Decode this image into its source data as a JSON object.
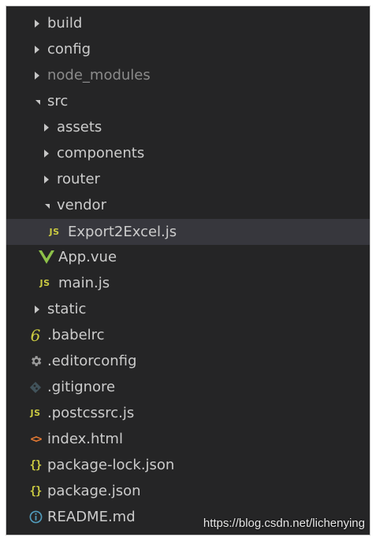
{
  "explorer": {
    "items": [
      {
        "label": "build",
        "kind": "folder",
        "state": "collapsed",
        "icon": "chevron-right-icon"
      },
      {
        "label": "config",
        "kind": "folder",
        "state": "collapsed",
        "icon": "chevron-right-icon"
      },
      {
        "label": "node_modules",
        "kind": "folder",
        "state": "collapsed",
        "icon": "chevron-right-icon",
        "dimmed": true
      },
      {
        "label": "src",
        "kind": "folder",
        "state": "expanded",
        "icon": "chevron-down-icon"
      },
      {
        "label": "assets",
        "kind": "folder",
        "state": "collapsed",
        "icon": "chevron-right-icon"
      },
      {
        "label": "components",
        "kind": "folder",
        "state": "collapsed",
        "icon": "chevron-right-icon"
      },
      {
        "label": "router",
        "kind": "folder",
        "state": "collapsed",
        "icon": "chevron-right-icon"
      },
      {
        "label": "vendor",
        "kind": "folder",
        "state": "expanded",
        "icon": "chevron-down-icon"
      },
      {
        "label": "Export2Excel.js",
        "kind": "file",
        "icon": "js-file-icon",
        "icon_text": "JS",
        "selected": true
      },
      {
        "label": "App.vue",
        "kind": "file",
        "icon": "vue-file-icon"
      },
      {
        "label": "main.js",
        "kind": "file",
        "icon": "js-file-icon",
        "icon_text": "JS"
      },
      {
        "label": "static",
        "kind": "folder",
        "state": "collapsed",
        "icon": "chevron-right-icon"
      },
      {
        "label": ".babelrc",
        "kind": "file",
        "icon": "babel-file-icon",
        "icon_text": "6"
      },
      {
        "label": ".editorconfig",
        "kind": "file",
        "icon": "gear-icon"
      },
      {
        "label": ".gitignore",
        "kind": "file",
        "icon": "git-icon"
      },
      {
        "label": ".postcssrc.js",
        "kind": "file",
        "icon": "js-file-icon",
        "icon_text": "JS"
      },
      {
        "label": "index.html",
        "kind": "file",
        "icon": "html-file-icon",
        "icon_text": "<>"
      },
      {
        "label": "package-lock.json",
        "kind": "file",
        "icon": "json-file-icon",
        "icon_text": "{}"
      },
      {
        "label": "package.json",
        "kind": "file",
        "icon": "json-file-icon",
        "icon_text": "{}"
      },
      {
        "label": "README.md",
        "kind": "file",
        "icon": "info-icon"
      }
    ]
  },
  "watermark": "https://blog.csdn.net/lichenying",
  "colors": {
    "background": "#252526",
    "selected_row": "#37373d",
    "text": "#cccccc",
    "dim_text": "#8b8b8b",
    "js_yellow": "#cbcb41",
    "vue_green": "#8dc149",
    "html_orange": "#e37933",
    "info_blue": "#519aba"
  }
}
